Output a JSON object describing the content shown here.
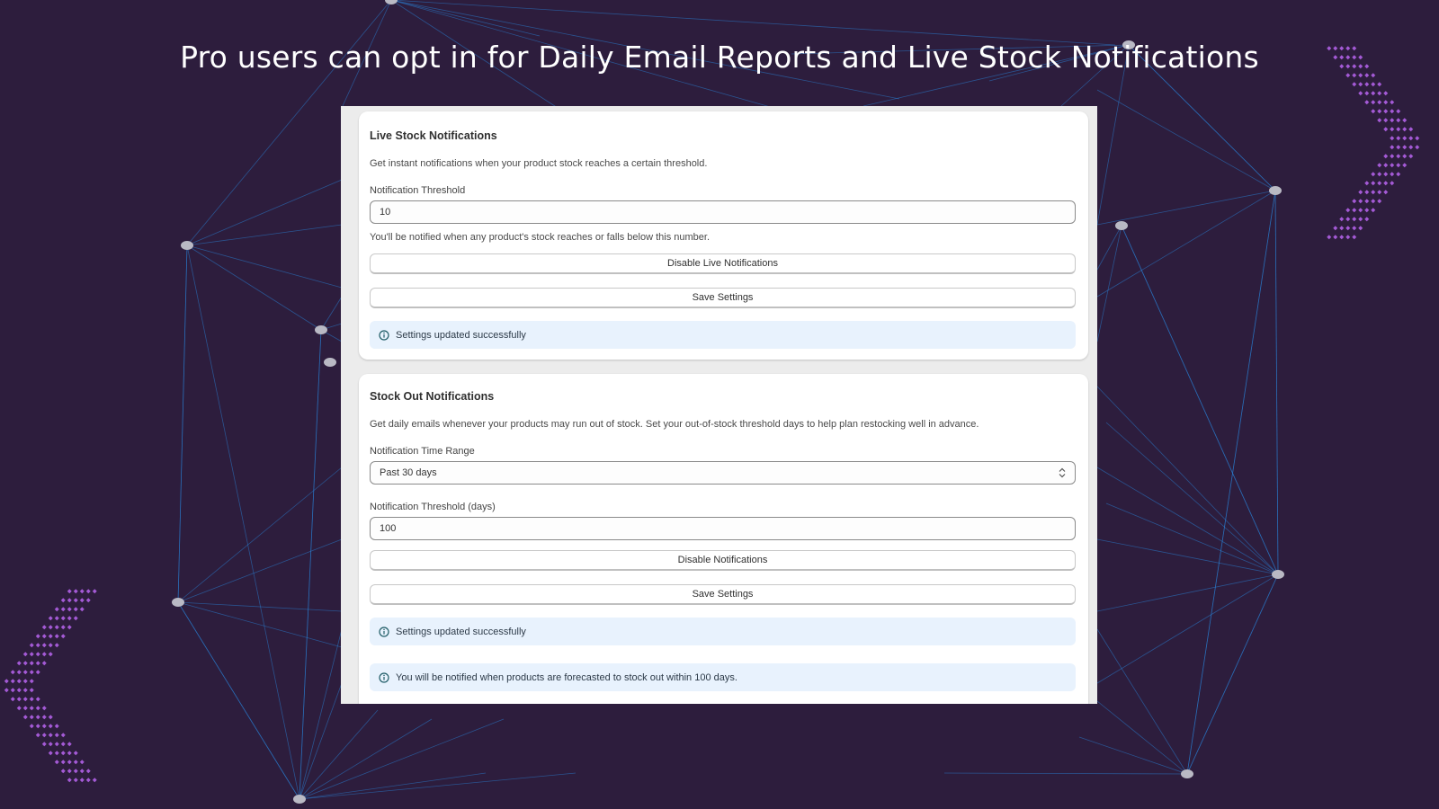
{
  "headline": "Pro users can opt in for Daily Email Reports and Live Stock Notifications",
  "colors": {
    "background": "#2d1d3d",
    "network_line": "#2a7fd4",
    "node": "#b9b9c4",
    "dot_pattern": "#a45ad6",
    "banner": "#e8f2fd"
  },
  "live_stock": {
    "title": "Live Stock Notifications",
    "description": "Get instant notifications when your product stock reaches a certain threshold.",
    "threshold_label": "Notification Threshold",
    "threshold_value": "10",
    "helper": "You'll be notified when any product's stock reaches or falls below this number.",
    "disable_label": "Disable Live Notifications",
    "save_label": "Save Settings",
    "success_message": "Settings updated successfully",
    "info_icon": "info-circle-icon"
  },
  "stock_out": {
    "title": "Stock Out Notifications",
    "description": "Get daily emails whenever your products may run out of stock. Set your out-of-stock threshold days to help plan restocking well in advance.",
    "time_range_label": "Notification Time Range",
    "time_range_value": "Past 30 days",
    "threshold_label": "Notification Threshold (days)",
    "threshold_value": "100",
    "disable_label": "Disable Notifications",
    "save_label": "Save Settings",
    "success_message": "Settings updated successfully",
    "forecast_message": "You will be notified when products are forecasted to stock out within 100 days.",
    "select_icon": "chevron-up-down-icon"
  }
}
